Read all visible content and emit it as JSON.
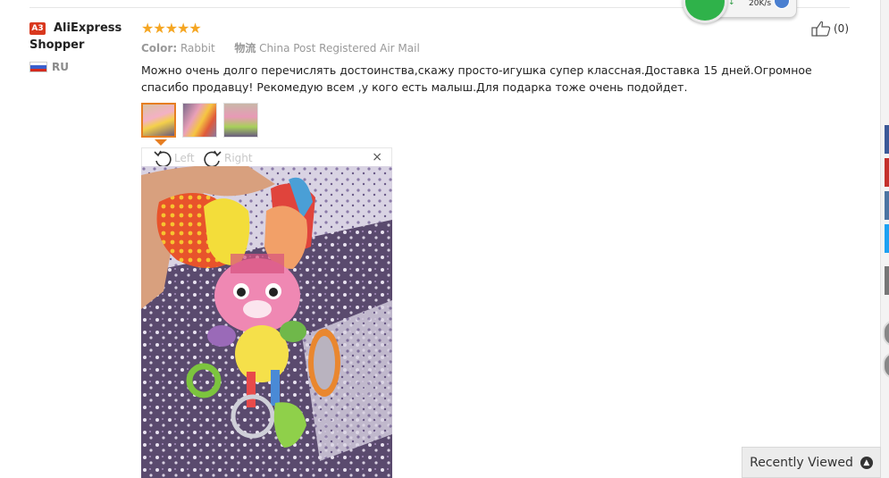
{
  "review": {
    "user": {
      "level": "A3",
      "name": "AliExpress Shopper",
      "country": "RU"
    },
    "rating": {
      "stars_text": "★★★★★",
      "value": 5,
      "max": 5
    },
    "color_label": "Color:",
    "color_value": "Rabbit",
    "shipping_label": "物流",
    "shipping_value": "China Post Registered Air Mail",
    "text": "Можно очень долго перечислять достоинства,скажу просто-игушка супер классная.Доставка 15 дней.Огромное спасибо продавцу! Рекомедую всем ,у кого есть малыш.Для подарка тоже очень подойдет.",
    "likes": "(0)",
    "thumbnails": [
      "photo-1",
      "photo-2",
      "photo-3"
    ]
  },
  "viewer": {
    "rotate_left": "Left",
    "rotate_right": "Right",
    "close": "×"
  },
  "net_widget": {
    "speed": "20K/s",
    "arrow": "↓"
  },
  "recently_viewed": {
    "label": "Recently Viewed"
  },
  "colors": {
    "accent": "#e67e22",
    "star": "#f5a623",
    "badge": "#d9381e",
    "green": "#2fb24a"
  }
}
